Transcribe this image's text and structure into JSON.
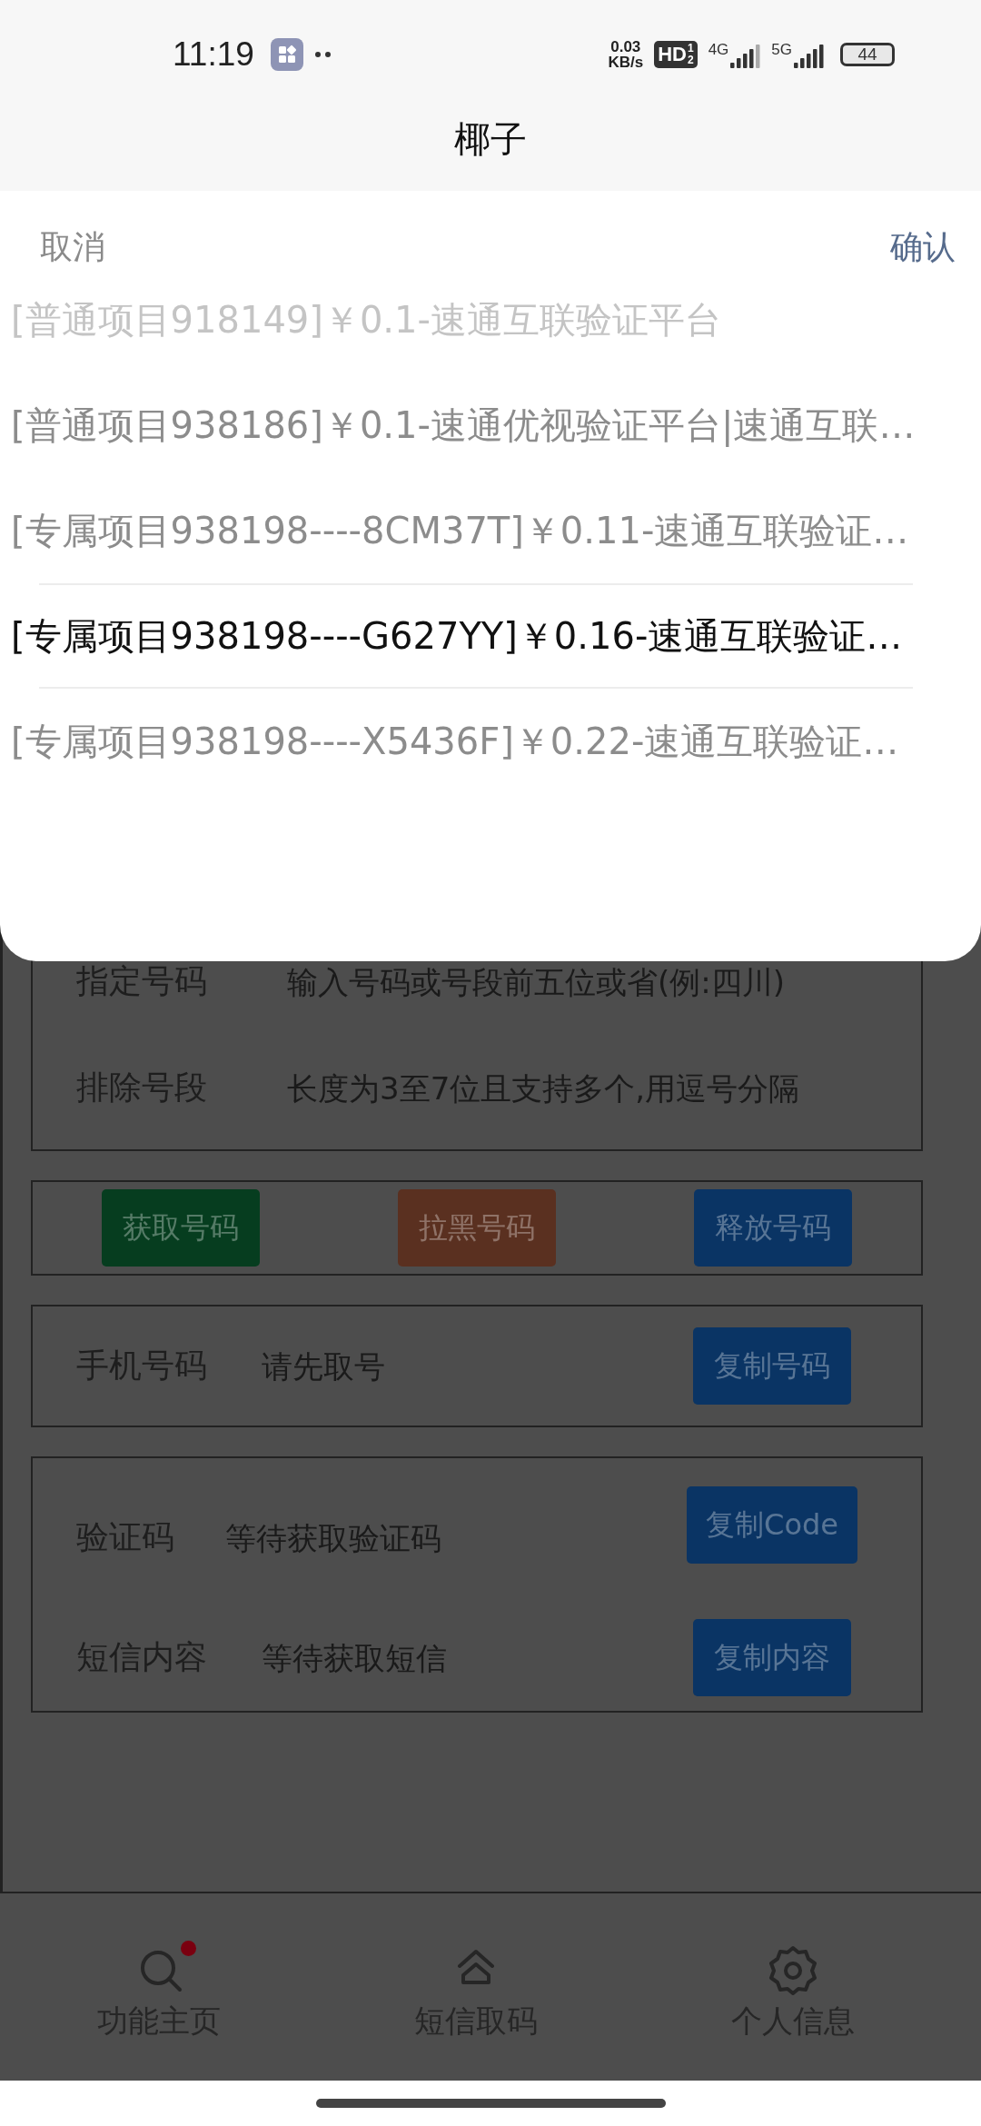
{
  "status_bar": {
    "time": "11:19",
    "speed_value": "0.03",
    "speed_unit": "KB/s",
    "hd_label": "HD",
    "hd_lines": [
      "1",
      "2"
    ],
    "networks": [
      "4G",
      "5G"
    ],
    "battery": "44"
  },
  "header": {
    "title": "椰子"
  },
  "picker": {
    "cancel": "取消",
    "confirm": "确认",
    "options": [
      {
        "label": "[普通项目918149]￥0.1-速通互联验证平台",
        "selected": false
      },
      {
        "label": "[普通项目938186]￥0.1-速通优视验证平台|速通互联…",
        "selected": false
      },
      {
        "label": "[专属项目938198----8CM37T]￥0.11-速通互联验证…",
        "selected": false
      },
      {
        "label": "[专属项目938198----G627YY]￥0.16-速通互联验证…",
        "selected": true
      },
      {
        "label": "[专属项目938198----X5436F]￥0.22-速通互联验证…",
        "selected": false
      }
    ]
  },
  "filters": [
    {
      "label": "指定号码",
      "placeholder": "输入号码或号段前五位或省(例:四川)"
    },
    {
      "label": "排除号段",
      "placeholder": "长度为3至7位且支持多个,用逗号分隔"
    }
  ],
  "actions": [
    {
      "label": "获取号码",
      "color": "#063d1f"
    },
    {
      "label": "拉黑号码",
      "color": "#5a3020"
    },
    {
      "label": "释放号码",
      "color": "#0a3464"
    }
  ],
  "phone": {
    "label": "手机号码",
    "placeholder": "请先取号",
    "button": "复制号码"
  },
  "messages": [
    {
      "label": "验证码",
      "placeholder": "等待获取验证码",
      "button": "复制Code"
    },
    {
      "label": "短信内容",
      "placeholder": "等待获取短信",
      "button": "复制内容"
    }
  ],
  "nav": [
    {
      "label": "功能主页",
      "kind": "search",
      "dot": true
    },
    {
      "label": "短信取码",
      "kind": "home",
      "dot": false
    },
    {
      "label": "个人信息",
      "kind": "settings",
      "dot": false
    }
  ]
}
